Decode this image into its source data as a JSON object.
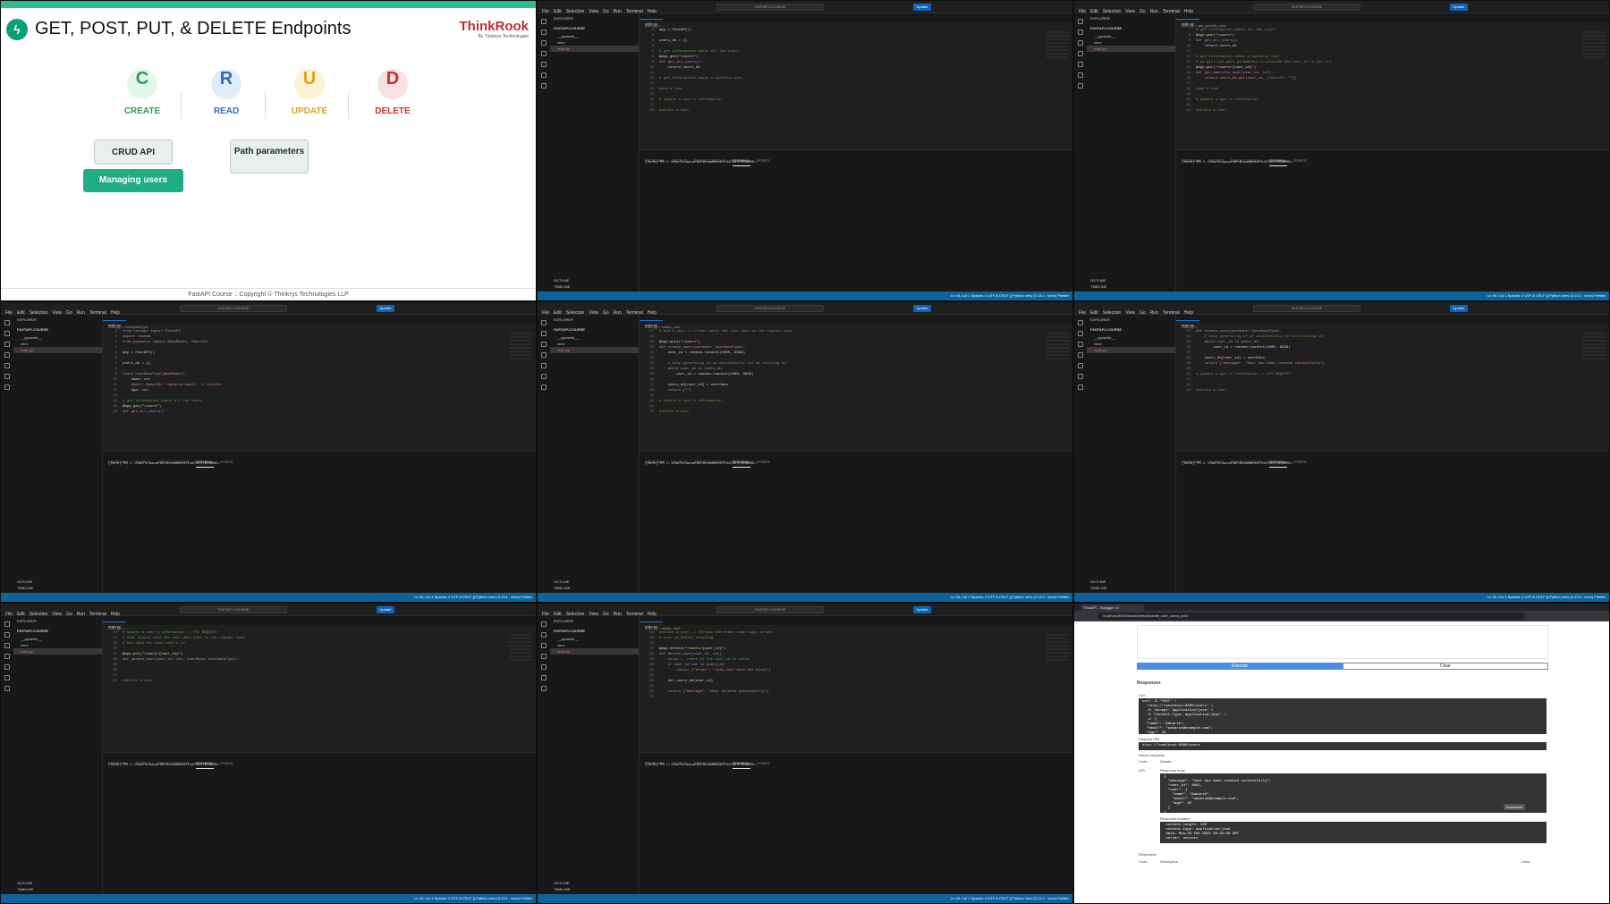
{
  "slide": {
    "title": "GET, POST, PUT, & DELETE Endpoints",
    "brand": "ThinkRook",
    "brand_sub": "By Thinkrys Technologies",
    "crud": [
      {
        "letter": "C",
        "label": "CREATE",
        "color": "#2e9b57",
        "bg": "#e3f6ea"
      },
      {
        "letter": "R",
        "label": "READ",
        "color": "#2f6fb3",
        "bg": "#e1edf8"
      },
      {
        "letter": "U",
        "label": "UPDATE",
        "color": "#d6a720",
        "bg": "#fbf2d3"
      },
      {
        "letter": "D",
        "label": "DELETE",
        "color": "#c8312c",
        "bg": "#f9e1e1"
      }
    ],
    "pill_crud": "CRUD API",
    "pill_users": "Managing users",
    "pill_path": "Path parameters",
    "footer": "FastAPI Course :: Copyright © Thinkrys Technologies LLP"
  },
  "vscode": {
    "menu": [
      "File",
      "Edit",
      "Selection",
      "View",
      "Go",
      "Run",
      "Terminal",
      "Help"
    ],
    "search": "FASTAPI-COURSE",
    "update": "Update",
    "explorer": "EXPLORER",
    "project": "FASTAPI-COURSE",
    "files": [
      "__pycache__",
      "venv",
      "main.py"
    ],
    "outline": "OUTLINE",
    "timeline": "TIMELINE",
    "tab": "main.py",
    "panel_tabs": [
      "PROBLEMS",
      "OUTPUT",
      "DEBUG CONSOLE",
      "TERMINAL",
      "PORTS"
    ],
    "terminal": "(venv) PS C:\\Users\\Aakarsh\\Documents\\FASTAPI-COURSE>",
    "status_left": "⊗ 0 ⚠ 0",
    "status_right": "Ln 45, Col 1   Spaces: 4   UTF-8   CRLF   {} Python   venv (3.13.1 : venv)   Prettier"
  },
  "panels": [
    {
      "crumb": "main.py > ...",
      "lines": [
        [
          "3",
          "app = FastAPI()",
          "t"
        ],
        [
          "4",
          "",
          "t"
        ],
        [
          "5",
          "users_db = {}",
          "t"
        ],
        [
          "6",
          "",
          "t"
        ],
        [
          "7",
          "# get information about all the users",
          "c"
        ],
        [
          "8",
          "@app.get(\"/users\")",
          "d"
        ],
        [
          "9",
          "def get_all_users():",
          "k"
        ],
        [
          "10",
          "    return users_db",
          "t"
        ],
        [
          "11",
          "",
          "t"
        ],
        [
          "12",
          "# get information about a specific user",
          "c"
        ],
        [
          "13",
          "",
          "t"
        ],
        [
          "14",
          "#add a user",
          "c"
        ],
        [
          "15",
          "",
          "t"
        ],
        [
          "16",
          "# update a user's information",
          "c"
        ],
        [
          "17",
          "",
          "t"
        ],
        [
          "18",
          "#delete a user",
          "c"
        ]
      ]
    },
    {
      "crumb": "main.py > get_specific_user",
      "lines": [
        [
          "7",
          "# get information about all the users",
          "c"
        ],
        [
          "8",
          "@app.get(\"/users\")",
          "d"
        ],
        [
          "9",
          "def get_all_users():",
          "k"
        ],
        [
          "10",
          "    return users_db",
          "t"
        ],
        [
          "11",
          "",
          "t"
        ],
        [
          "12",
          "# get information about a specific user",
          "c"
        ],
        [
          "13",
          "# we will use path parameters to provide the user_id in the url",
          "c"
        ],
        [
          "14",
          "@app.get(\"/users/{user_id}\")",
          "d"
        ],
        [
          "15",
          "def get_specific_user(user_id: int):",
          "k"
        ],
        [
          "16",
          "    return users_db.get(user_id, {\"error\": \"\"})",
          "s"
        ],
        [
          "17",
          "",
          "t"
        ],
        [
          "18",
          "#add a user",
          "c"
        ],
        [
          "19",
          "",
          "t"
        ],
        [
          "20",
          "# update a user's information",
          "c"
        ],
        [
          "21",
          "",
          "t"
        ],
        [
          "22",
          "#delete a user",
          "c"
        ]
      ]
    },
    {
      "crumb": "main.py > UserDataType",
      "lines": [
        [
          "1",
          "from fastapi import FastAPI",
          "k"
        ],
        [
          "2",
          "import random",
          "k"
        ],
        [
          "3",
          "from pydantic import BaseModel, EmailStr",
          "k"
        ],
        [
          "4",
          "",
          "t"
        ],
        [
          "5",
          "app = FastAPI()",
          "t"
        ],
        [
          "6",
          "",
          "t"
        ],
        [
          "7",
          "users_db = {}",
          "t"
        ],
        [
          "8",
          "",
          "t"
        ],
        [
          "9",
          "class UserDataType(BaseModel):",
          "k"
        ],
        [
          "10",
          "    name: str",
          "t"
        ],
        [
          "11",
          "    email: EmailStr \"aakarsh-email\" -> invalid",
          "s"
        ],
        [
          "12",
          "    age: int",
          "t"
        ],
        [
          "13",
          "",
          "t"
        ],
        [
          "14",
          "# get information about all the users",
          "c"
        ],
        [
          "15",
          "@app.get(\"/users\")",
          "d"
        ],
        [
          "16",
          "def get_all_users():",
          "k"
        ]
      ]
    },
    {
      "crumb": "main.py > create_user",
      "lines": [
        [
          "27",
          "# add a user -> client sends the json data in the request body",
          "c"
        ],
        [
          "28",
          "",
          "t"
        ],
        [
          "29",
          "@app.post(\"/users\")",
          "d"
        ],
        [
          "30",
          "def create_user(userData: UserDataType):",
          "k"
        ],
        [
          "31",
          "    user_id = random.randint(1000, 9999)",
          "t"
        ],
        [
          "32",
          "",
          "t"
        ],
        [
          "33",
          "    # keep generating if we accidentally hit an existing id",
          "c"
        ],
        [
          "34",
          "    while user_id in users_db:",
          "k"
        ],
        [
          "35",
          "        user_id = random.randint(1000, 9999)",
          "t"
        ],
        [
          "36",
          "",
          "t"
        ],
        [
          "37",
          "    users_db[user_id] = userData",
          "t"
        ],
        [
          "38",
          "    return {\"\"}",
          "s"
        ],
        [
          "39",
          "",
          "t"
        ],
        [
          "40",
          "# update a user's information",
          "c"
        ],
        [
          "41",
          "",
          "t"
        ],
        [
          "42",
          "#delete a user",
          "c"
        ]
      ]
    },
    {
      "crumb": "main.py > ...",
      "lines": [
        [
          "33",
          "def create_user(userData: UserDataType):",
          "k"
        ],
        [
          "34",
          "    # keep generating if we accidentally hit an existing id",
          "c"
        ],
        [
          "35",
          "    while user_id in users_db:",
          "k"
        ],
        [
          "36",
          "        user_id = random.randint(1000, 9999)",
          "t"
        ],
        [
          "37",
          "",
          "t"
        ],
        [
          "38",
          "    users_db[user_id] = userData",
          "t"
        ],
        [
          "39",
          "    return {\"message\": \"User has been created successfully\"}",
          "s"
        ],
        [
          "40",
          "",
          "t"
        ],
        [
          "41",
          "# update a user's information -> PUT REQUEST",
          "c"
        ],
        [
          "42",
          "",
          "t"
        ],
        [
          "43",
          "",
          "t"
        ],
        [
          "44",
          "#delete a user",
          "c"
        ]
      ]
    },
    {
      "crumb": "main.py > ...",
      "lines": [
        [
          "43",
          "# update a user's information -> PUT REQUEST",
          "c"
        ],
        [
          "44",
          "# user should send the user data json in the request body",
          "c"
        ],
        [
          "45",
          "# the data for that user's id",
          "c"
        ],
        [
          "46",
          "",
          "t"
        ],
        [
          "47",
          "@app.put(\"/users/{user_id}\")",
          "d"
        ],
        [
          "48",
          "def update_user(user_id: int, userData: UserDataType):",
          "k"
        ],
        [
          "49",
          "",
          "t"
        ],
        [
          "50",
          "",
          "t"
        ],
        [
          "51",
          "",
          "t"
        ],
        [
          "52",
          "#delete a user",
          "c"
        ]
      ]
    },
    {
      "crumb": "main.py > delete_user",
      "lines": [
        [
          "54",
          "#delete a user -> follows the exact same logic as put",
          "c"
        ],
        [
          "55",
          "# user id before deleting.",
          "c"
        ],
        [
          "56",
          "",
          "t"
        ],
        [
          "57",
          "@app.delete(\"/users/{user_id}\")",
          "d"
        ],
        [
          "58",
          "def delete_user(user_id: int):",
          "k"
        ],
        [
          "59",
          "    #step 1 -check if the user_id is valid",
          "c"
        ],
        [
          "60",
          "    if user_id not in users_db:",
          "k"
        ],
        [
          "61",
          "        return {\"error\": \"this user does not exist\"}",
          "s"
        ],
        [
          "62",
          "",
          "t"
        ],
        [
          "63",
          "    del users_db[user_id]",
          "t"
        ],
        [
          "64",
          "",
          "t"
        ],
        [
          "65",
          "    return {\"message\": \"User deleted successfully\"}",
          "s"
        ],
        [
          "66",
          "",
          "t"
        ]
      ]
    }
  ],
  "browser": {
    "tab": "FastAPI - Swagger UI",
    "url": "localhost:8000/docs#/default/create_user_users_post",
    "execute": "Execute",
    "clear": "Clear",
    "responses": "Responses",
    "curl": "Curl",
    "curl_code": "curl -X 'POST' \\\n  'http://localhost:8000/users' \\\n  -H 'accept: application/json' \\\n  -H 'Content-Type: application/json' \\\n  -d '{\n  \"name\": \"Aakarsh\",\n  \"email\": \"aakarsh@example.com\",\n  \"age\": 25\n}'",
    "request_url_label": "Request URL",
    "request_url": "http://localhost:8000/users",
    "server_response": "Server response",
    "code_label": "Code",
    "details_label": "Details",
    "code": "200",
    "response_body_label": "Response body",
    "response_body": "{\n  \"message\": \"User has been created successfully\",\n  \"user_id\": 4051,\n  \"user\": {\n    \"name\": \"Aakarsh\",\n    \"email\": \"aakarsh@example.com\",\n    \"age\": 25\n  }\n}",
    "download": "Download",
    "response_headers_label": "Response headers",
    "response_headers": " content-length: 138\n content-type: application/json\n date: Mon,03 Feb 2025 06:34:08 GMT\n server: uvicorn",
    "responses2": "Responses",
    "desc_label": "Description",
    "links_label": "Links"
  }
}
